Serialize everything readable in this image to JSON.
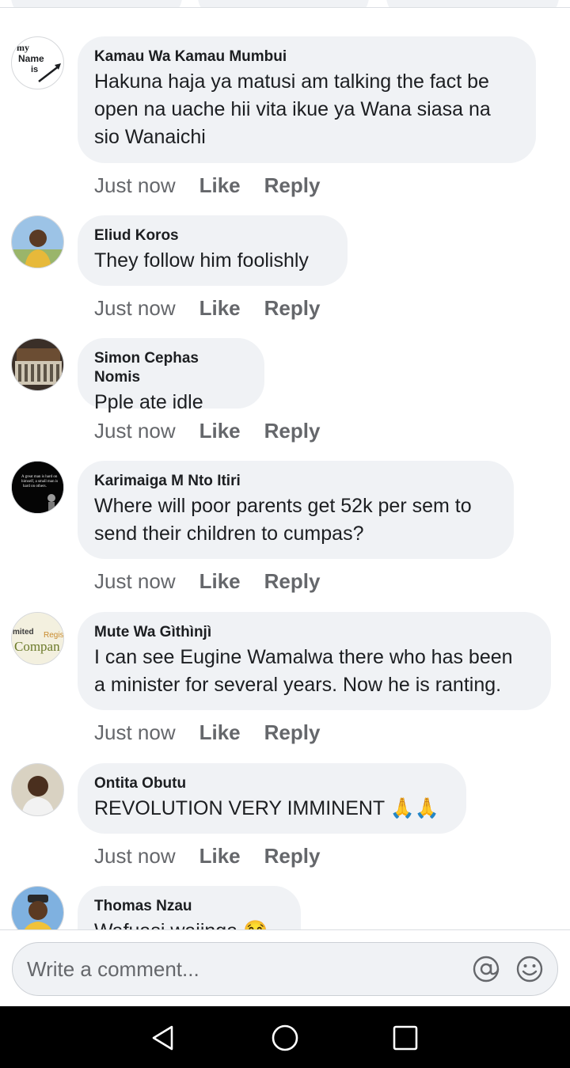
{
  "comments": [
    {
      "author": "Kamau Wa Kamau Mumbui",
      "text": "Hakuna haja ya matusi am talking the fact be\nopen na uache hii vita ikue ya Wana siasa na\nsio Wanaichi",
      "time": "Just now",
      "like": "Like",
      "reply": "Reply",
      "avatar": "my-name-is-avatar",
      "avatar_text": [
        "my",
        "Name",
        "is"
      ]
    },
    {
      "author": "Eliud Koros",
      "text": "They follow him foolishly",
      "time": "Just now",
      "like": "Like",
      "reply": "Reply",
      "avatar": "child-photo-avatar"
    },
    {
      "author": "Simon Cephas Nomis",
      "text": "Pple ate idle",
      "time": "Just now",
      "like": "Like",
      "reply": "Reply",
      "avatar": "building-photo-avatar"
    },
    {
      "author": "Karimaiga M Nto Itiri",
      "text": "Where will poor parents get 52k per sem to\nsend their children to cumpas?",
      "time": "Just now",
      "like": "Like",
      "reply": "Reply",
      "avatar": "quote-avatar",
      "avatar_text": [
        "A great man is hard on",
        "himself, a small man is",
        "hard on others."
      ]
    },
    {
      "author": "Mute Wa Gìthìnjì",
      "text": "I can see Eugine Wamalwa there who has been\na minister for several years. Now he is ranting.",
      "time": "Just now",
      "like": "Like",
      "reply": "Reply",
      "avatar": "word-cloud-avatar",
      "avatar_text": [
        "mited",
        "Regis",
        "Compan"
      ]
    },
    {
      "author": "Ontita Obutu",
      "text": "REVOLUTION VERY IMMINENT 🙏🙏",
      "time": "Just now",
      "like": "Like",
      "reply": "Reply",
      "avatar": "person-photo-avatar"
    },
    {
      "author": "Thomas Nzau",
      "text": "Wafuasi wajinga 😂",
      "time": "",
      "like": "",
      "reply": "",
      "avatar": "man-photo-avatar"
    }
  ],
  "composer": {
    "placeholder": "Write a comment...",
    "mention_icon": "at-icon",
    "emoji_icon": "smiley-icon"
  },
  "navbar": {
    "back_icon": "triangle-back-icon",
    "home_icon": "circle-home-icon",
    "recents_icon": "square-recents-icon"
  },
  "colors": {
    "bubble": "#f0f2f5",
    "meta_text": "#65676b",
    "navbar": "#000000"
  }
}
